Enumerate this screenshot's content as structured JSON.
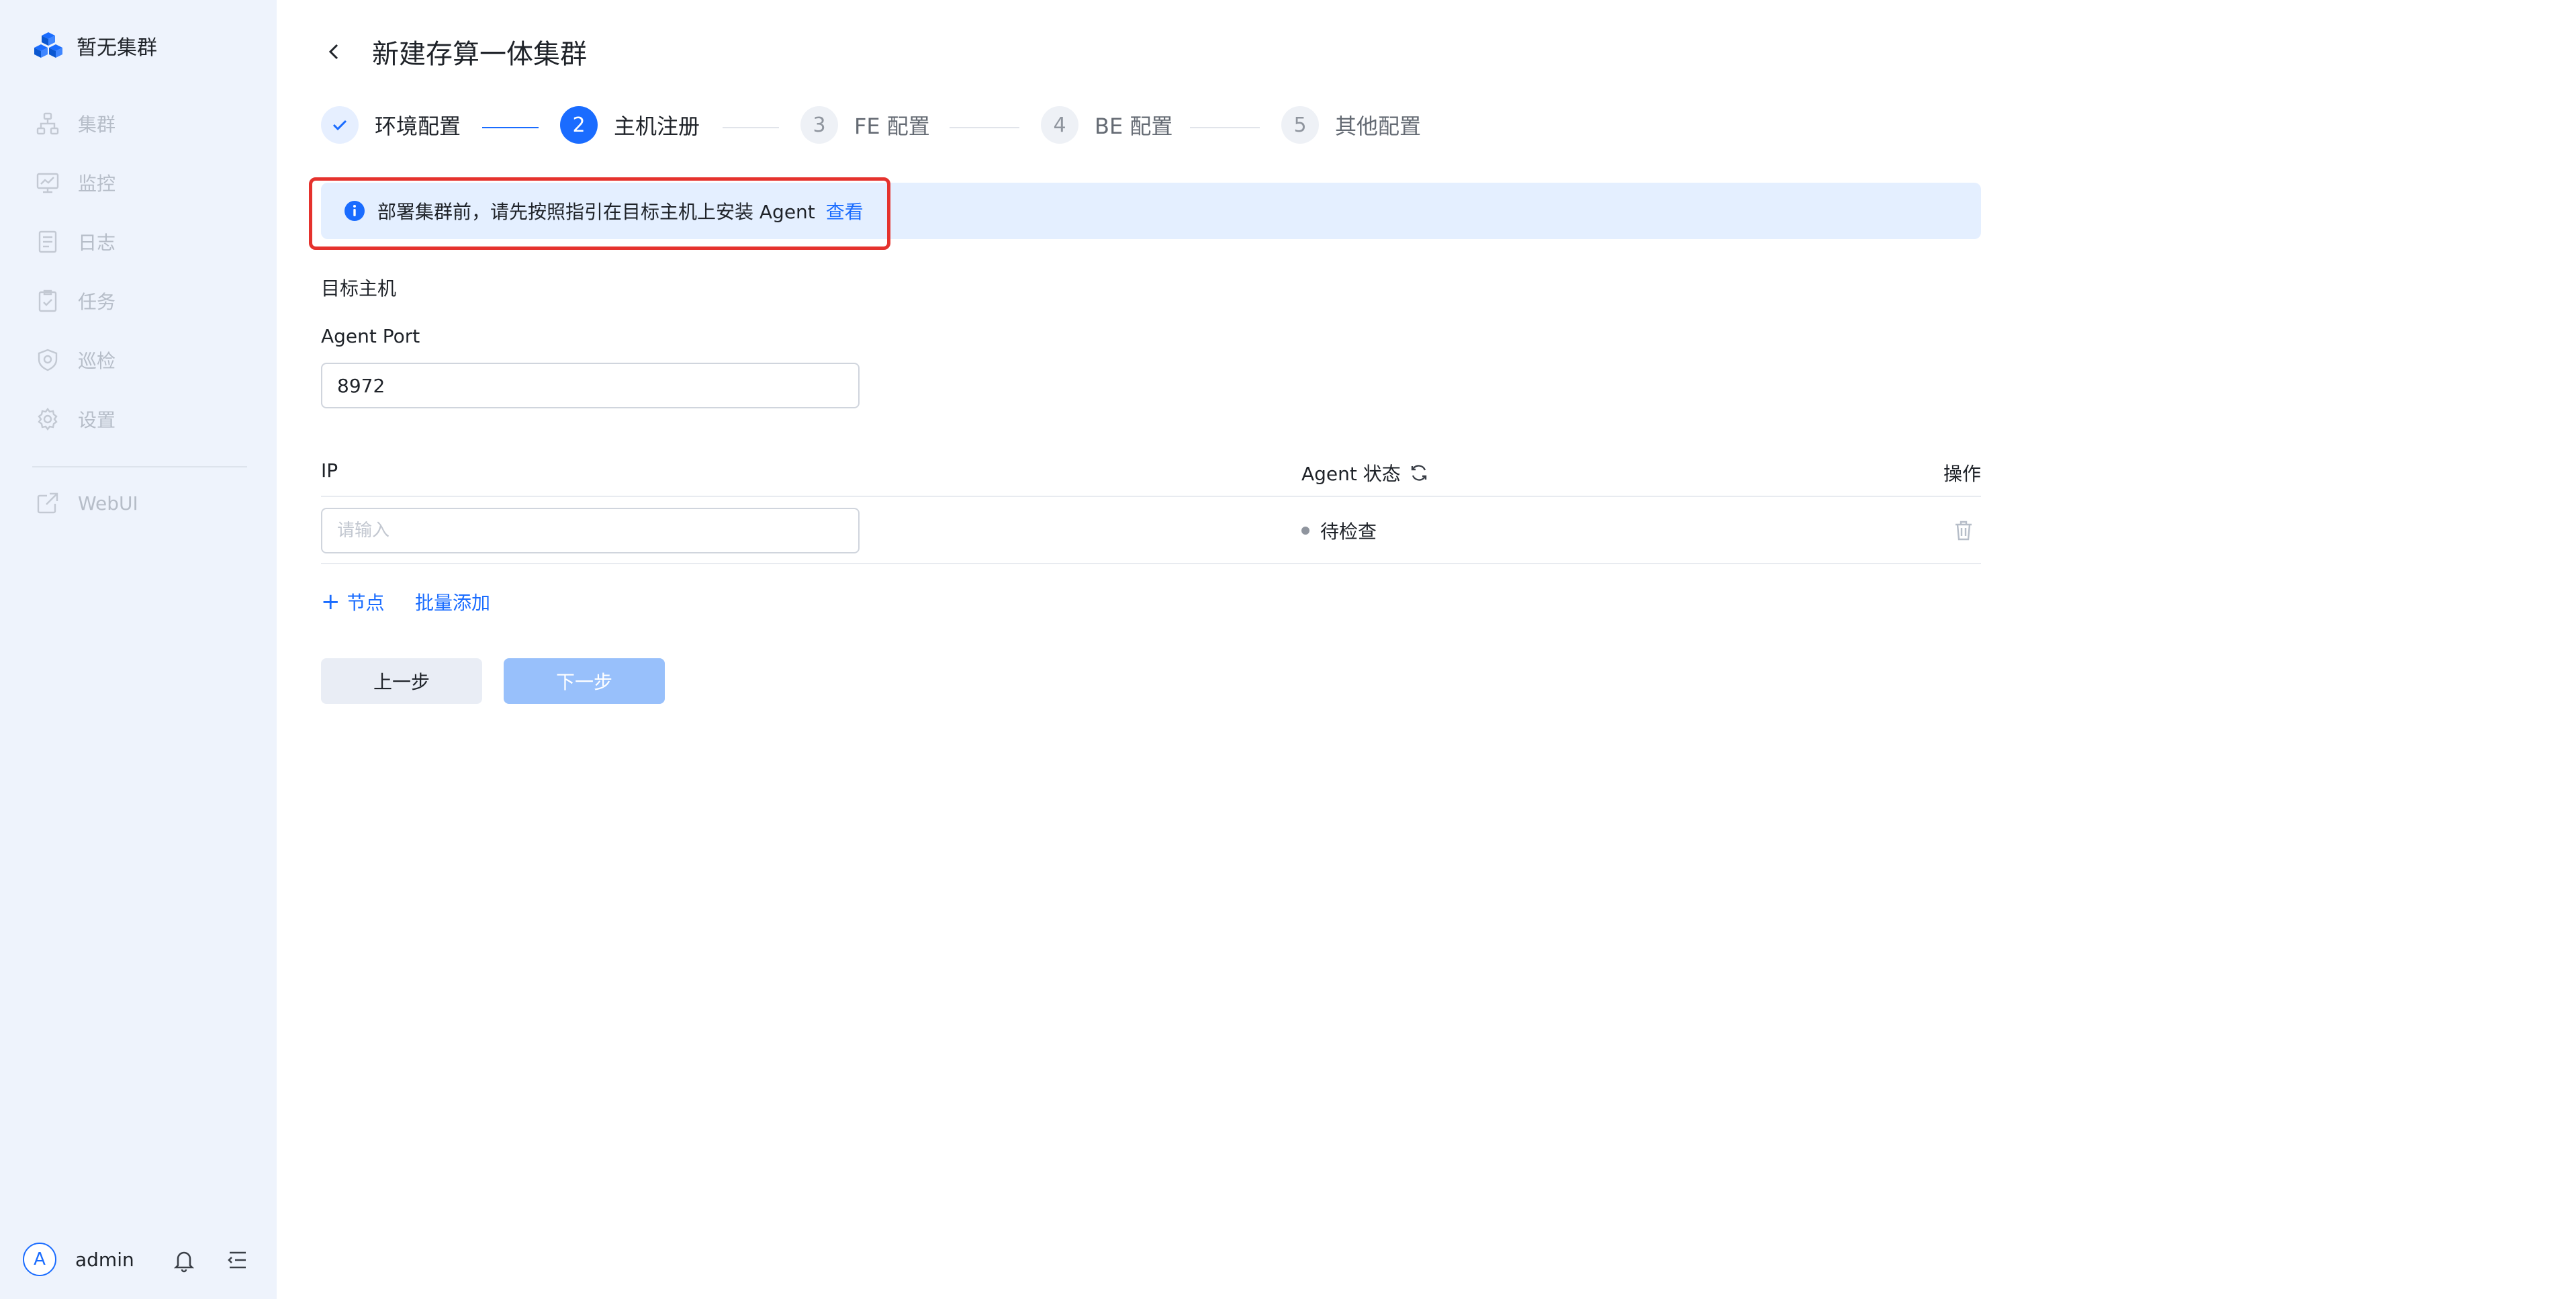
{
  "sidebar": {
    "brand": "暂无集群",
    "items": [
      {
        "label": "集群",
        "icon": "cluster-icon"
      },
      {
        "label": "监控",
        "icon": "monitor-icon"
      },
      {
        "label": "日志",
        "icon": "log-icon"
      },
      {
        "label": "任务",
        "icon": "task-icon"
      },
      {
        "label": "巡检",
        "icon": "inspection-icon"
      },
      {
        "label": "设置",
        "icon": "settings-icon"
      }
    ],
    "webui": {
      "label": "WebUI",
      "icon": "external-link-icon"
    },
    "user": {
      "avatar_letter": "A",
      "name": "admin"
    }
  },
  "header": {
    "title": "新建存算一体集群"
  },
  "steps": [
    {
      "number": "1",
      "label": "环境配置",
      "status": "done"
    },
    {
      "number": "2",
      "label": "主机注册",
      "status": "active"
    },
    {
      "number": "3",
      "label": "FE 配置",
      "status": "pending"
    },
    {
      "number": "4",
      "label": "BE 配置",
      "status": "pending"
    },
    {
      "number": "5",
      "label": "其他配置",
      "status": "pending"
    }
  ],
  "alert": {
    "text": "部署集群前，请先按照指引在目标主机上安装 Agent",
    "link": "查看"
  },
  "form": {
    "section_title": "目标主机",
    "port_label": "Agent Port",
    "port_value": "8972"
  },
  "table": {
    "columns": {
      "ip": "IP",
      "status": "Agent 状态",
      "action": "操作"
    },
    "rows": [
      {
        "ip_placeholder": "请输入",
        "status": "待检查"
      }
    ]
  },
  "actions": {
    "add_node": "节点",
    "batch_add": "批量添加",
    "prev": "上一步",
    "next": "下一步"
  },
  "colors": {
    "accent": "#1a6cff",
    "sidebar_bg": "#eef3fc",
    "alert_bg": "#e4efff",
    "highlight": "#e5322d"
  }
}
